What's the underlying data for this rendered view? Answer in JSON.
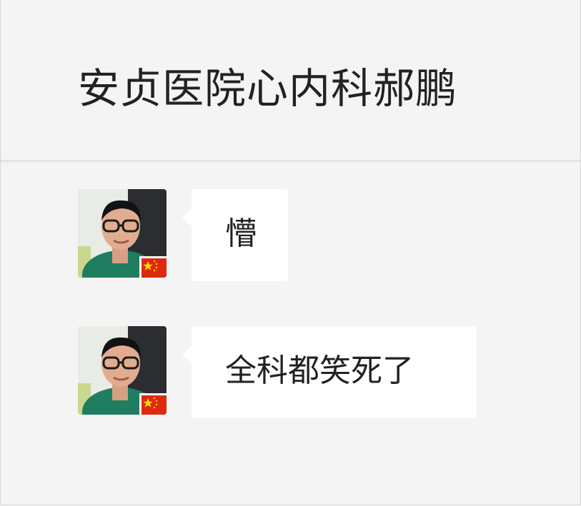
{
  "header": {
    "title": "安贞医院心内科郝鹏"
  },
  "messages": [
    {
      "sender_avatar": "doctor-avatar-photo",
      "badge": "china-flag-icon",
      "text": "懵"
    },
    {
      "sender_avatar": "doctor-avatar-photo",
      "badge": "china-flag-icon",
      "text": "全科都笑死了"
    }
  ],
  "colors": {
    "background": "#f4f4f4",
    "bubble": "#ffffff",
    "text": "#222222",
    "divider": "#e3e3e3",
    "flag_red": "#de2910",
    "flag_star": "#ffde00",
    "shirt_green": "#1f7d62"
  }
}
